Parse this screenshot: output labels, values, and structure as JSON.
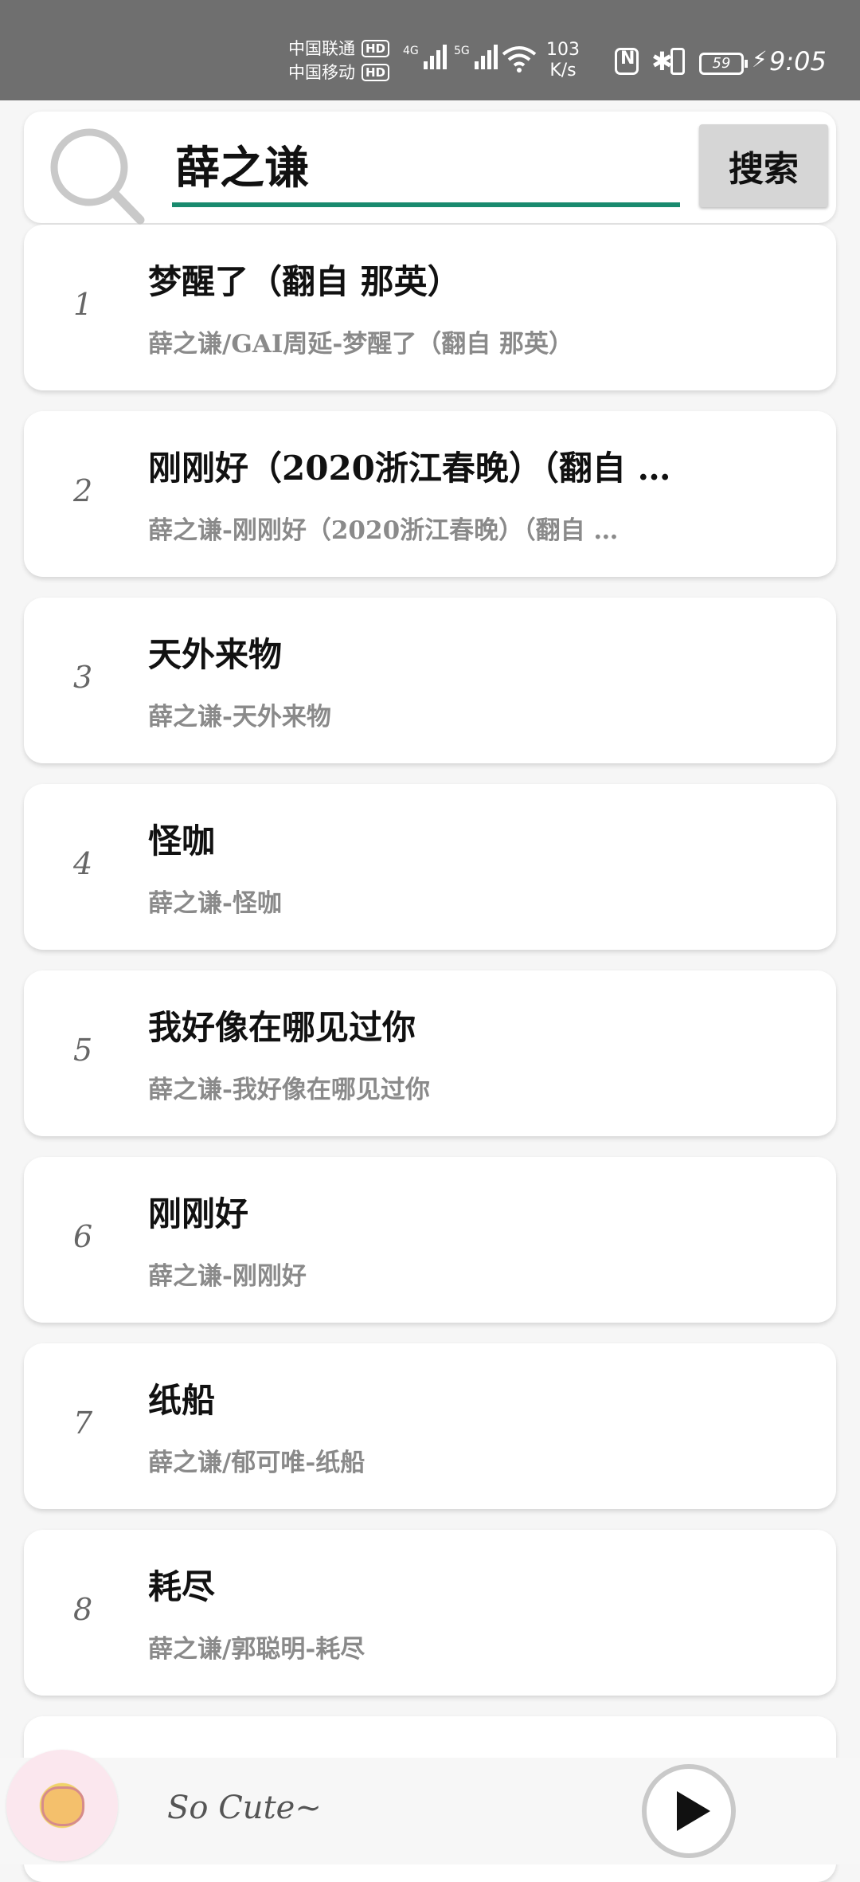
{
  "status": {
    "carrier1": "中国联通",
    "carrier2": "中国移动",
    "hd": "HD",
    "net1": "4G",
    "net2": "5G",
    "speed_value": "103",
    "speed_unit": "K/s",
    "battery": "59",
    "time": "9:05"
  },
  "search": {
    "value": "薛之谦",
    "button_label": "搜索"
  },
  "results": [
    {
      "index": "1",
      "title": "梦醒了（翻自 那英）",
      "subtitle": "薛之谦/GAI周延-梦醒了（翻自 那英）"
    },
    {
      "index": "2",
      "title": "刚刚好（2020浙江春晚）（翻自 …",
      "subtitle": "薛之谦-刚刚好（2020浙江春晚）（翻自 …"
    },
    {
      "index": "3",
      "title": "天外来物",
      "subtitle": "薛之谦-天外来物"
    },
    {
      "index": "4",
      "title": "怪咖",
      "subtitle": "薛之谦-怪咖"
    },
    {
      "index": "5",
      "title": "我好像在哪见过你",
      "subtitle": "薛之谦-我好像在哪见过你"
    },
    {
      "index": "6",
      "title": "刚刚好",
      "subtitle": "薛之谦-刚刚好"
    },
    {
      "index": "7",
      "title": "纸船",
      "subtitle": "薛之谦/郁可唯-纸船"
    },
    {
      "index": "8",
      "title": "耗尽",
      "subtitle": "薛之谦/郭聪明-耗尽"
    }
  ],
  "player": {
    "song": "So Cute~",
    "play_icon": "play-icon"
  }
}
